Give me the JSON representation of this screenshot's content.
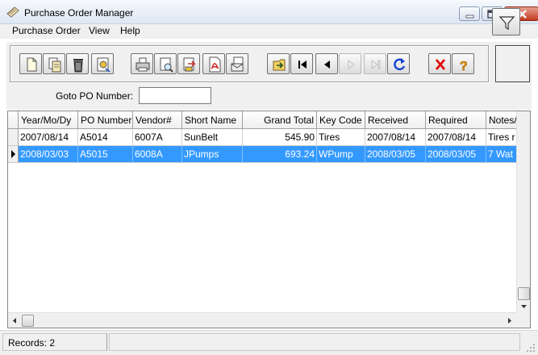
{
  "window": {
    "title": "Purchase Order Manager"
  },
  "menu": [
    "Purchase Order",
    "View",
    "Help"
  ],
  "toolbar": {
    "buttons": [
      "new-icon",
      "open-icon",
      "delete-icon",
      "edit-icon",
      "print-icon",
      "print-preview-icon",
      "export-icon",
      "pdf-icon",
      "email-icon",
      "goto-icon",
      "first-record-icon",
      "previous-record-icon",
      "next-record-icon",
      "last-record-icon",
      "refresh-icon",
      "cancel-icon",
      "help-icon"
    ],
    "filter_icon": "filter-icon"
  },
  "goto": {
    "label": "Goto PO Number:",
    "value": ""
  },
  "table": {
    "columns": [
      "Year/Mo/Dy",
      "PO Number",
      "Vendor#",
      "Short Name",
      "Grand Total",
      "Key Code",
      "Received",
      "Required",
      "Notes/"
    ],
    "rows": [
      [
        "2007/08/14",
        "A5014",
        "6007A",
        "SunBelt",
        "545.90",
        "Tires",
        "2007/08/14",
        "2007/08/14",
        "Tires r"
      ],
      [
        "2008/03/03",
        "A5015",
        "6008A",
        "JPumps",
        "693.24",
        "WPump",
        "2008/03/05",
        "2008/03/05",
        "7 Wat"
      ]
    ],
    "selected_row": 1
  },
  "status": {
    "records": "Records: 2"
  },
  "colors": {
    "selection": "#3399ff",
    "accent_close": "#c43b22"
  }
}
